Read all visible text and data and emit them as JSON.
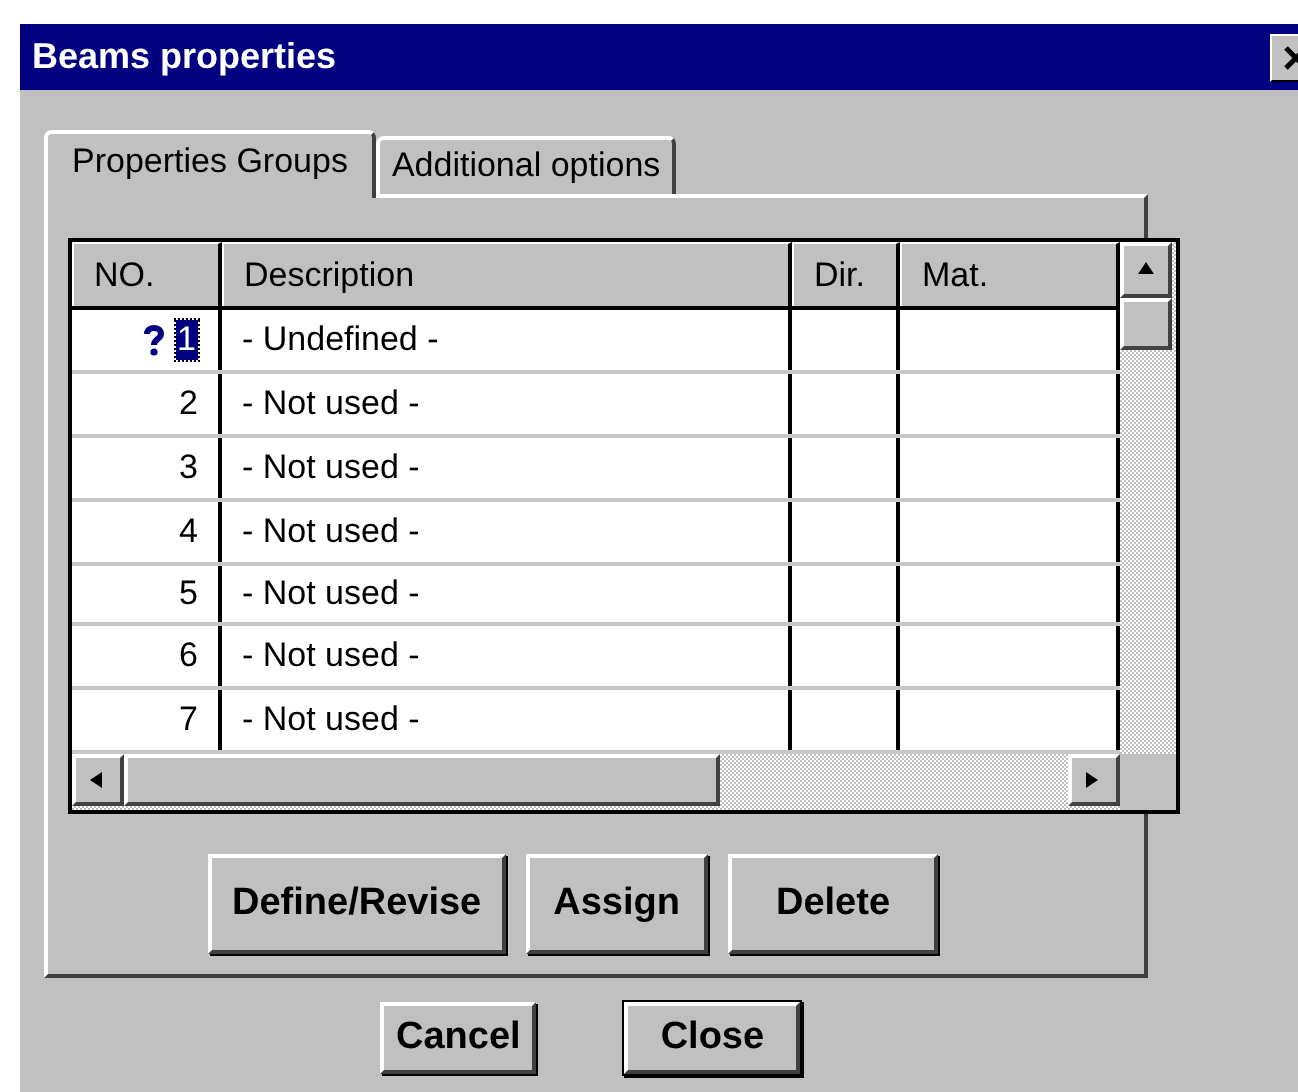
{
  "window": {
    "title": "Beams properties"
  },
  "tabs": [
    {
      "label": "Properties Groups",
      "selected": true
    },
    {
      "label": "Additional options",
      "selected": false
    }
  ],
  "table": {
    "columns": [
      "NO.",
      "Description",
      "Dir.",
      "Mat."
    ],
    "rows": [
      {
        "number": "1",
        "description": "- Undefined -",
        "flagged": true,
        "selected": true
      },
      {
        "number": "2",
        "description": "- Not used -",
        "flagged": false,
        "selected": false
      },
      {
        "number": "3",
        "description": "- Not used -",
        "flagged": false,
        "selected": false
      },
      {
        "number": "4",
        "description": "- Not used -",
        "flagged": false,
        "selected": false
      },
      {
        "number": "5",
        "description": "- Not used -",
        "flagged": false,
        "selected": false
      },
      {
        "number": "6",
        "description": "- Not used -",
        "flagged": false,
        "selected": false
      },
      {
        "number": "7",
        "description": "- Not used -",
        "flagged": false,
        "selected": false
      }
    ]
  },
  "panel_buttons": [
    "Define/Revise",
    "Assign",
    "Delete"
  ],
  "dialog_buttons": [
    {
      "label": "Cancel",
      "default": false
    },
    {
      "label": "Close",
      "default": true
    }
  ]
}
